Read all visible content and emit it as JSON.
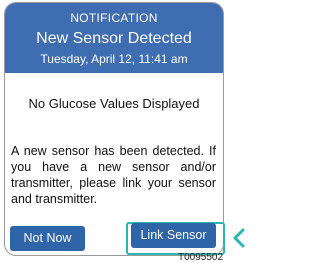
{
  "notification": {
    "label": "NOTIFICATION",
    "title": "New Sensor Detected",
    "date": "Tuesday, April 12, 11:41 am",
    "subtitle": "No Glucose Values Displayed",
    "message": "A new sensor has been detected. If you have a new sensor and/or transmitter, please link your sensor and transmitter.",
    "buttons": {
      "not_now": "Not Now",
      "link_sensor": "Link Sensor"
    }
  },
  "callout": {
    "arrow_icon": "chevron-left-icon",
    "color": "#2cb6b1"
  },
  "figure_code": "T0095502",
  "colors": {
    "header": "#3f6db1",
    "button": "#2d65a8"
  }
}
